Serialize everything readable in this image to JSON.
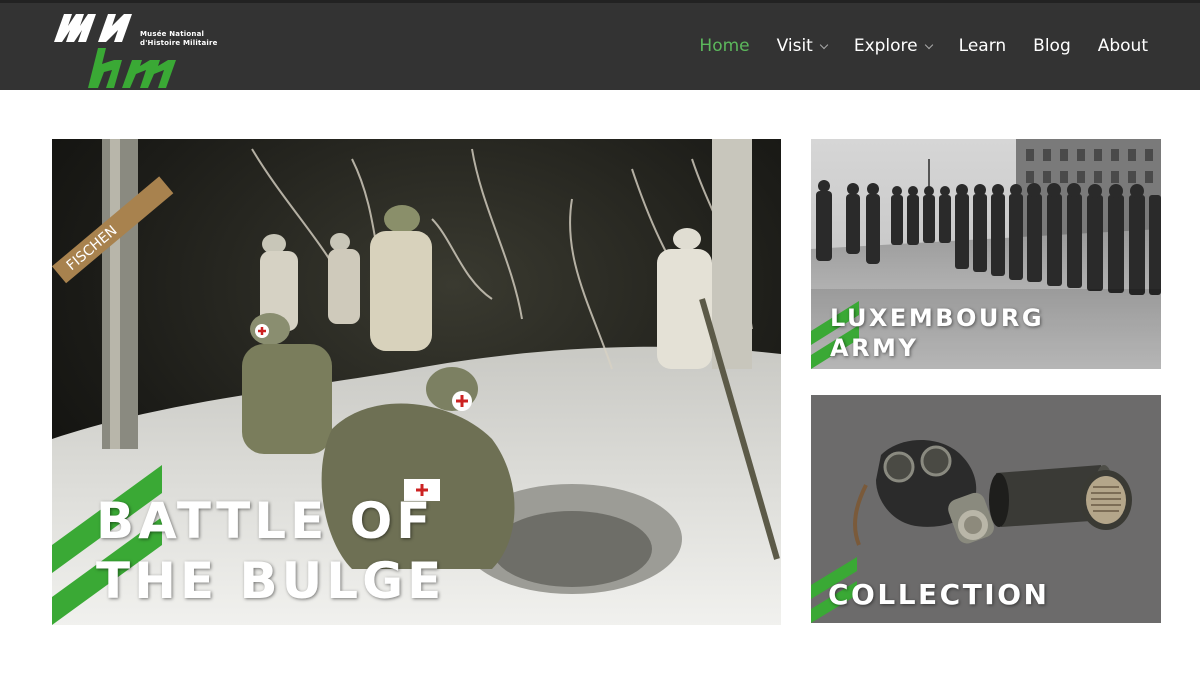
{
  "header": {
    "logo": {
      "letters_top": "MN",
      "letters_bottom": "hm",
      "line1": "Musée National",
      "line2": "d'Histoire Militaire"
    },
    "nav": [
      {
        "label": "Home",
        "active": true,
        "has_dropdown": false
      },
      {
        "label": "Visit",
        "active": false,
        "has_dropdown": true
      },
      {
        "label": "Explore",
        "active": false,
        "has_dropdown": true
      },
      {
        "label": "Learn",
        "active": false,
        "has_dropdown": false
      },
      {
        "label": "Blog",
        "active": false,
        "has_dropdown": false
      },
      {
        "label": "About",
        "active": false,
        "has_dropdown": false
      }
    ]
  },
  "tiles": {
    "bulge": {
      "title_line1": "BATTLE OF",
      "title_line2": "THE BULGE",
      "sign_text": "FISCHEN"
    },
    "army": {
      "title_line1": "LUXEMBOURG",
      "title_line2": "ARMY"
    },
    "collection": {
      "title": "COLLECTION"
    }
  },
  "colors": {
    "header_bg": "#333333",
    "accent_green": "#5cb85c",
    "stripe_green": "#3aa935",
    "collection_bg": "#6c6b6b"
  }
}
